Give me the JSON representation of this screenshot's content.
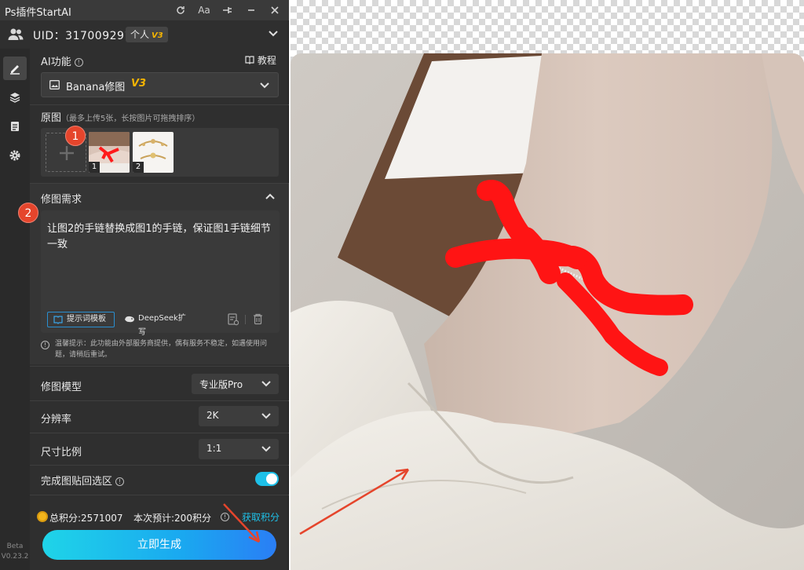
{
  "window": {
    "title": "Ps插件StartAI"
  },
  "user": {
    "uid": "UID：317009291",
    "tag": "个人",
    "tag_version": "V3"
  },
  "ai_function": {
    "label": "AI功能",
    "tutorial": "教程",
    "selected": "Banana修图",
    "selected_version": "V3"
  },
  "source_images": {
    "label": "原图",
    "hint": "（最多上传5张，长按图片可拖拽排序）",
    "items": [
      {
        "num": "1"
      },
      {
        "num": "2"
      }
    ]
  },
  "annotations": {
    "badge1": "1",
    "badge2": "2"
  },
  "edit_request": {
    "label": "修图需求",
    "text": "让图2的手链替换成图1的手链，保证图1手链细节一致",
    "template_button": "提示词模板",
    "deepseek_button": "DeepSeek扩写"
  },
  "notice": {
    "text": "温馨提示：此功能由外部服务商提供，偶有服务不稳定，如遇使用问题，请稍后重试。"
  },
  "settings": {
    "model": {
      "label": "修图模型",
      "value": "专业版Pro"
    },
    "resolution": {
      "label": "分辨率",
      "value": "2K"
    },
    "aspect": {
      "label": "尺寸比例",
      "value": "1:1"
    },
    "paste_back": {
      "label": "完成图贴回选区",
      "enabled": true
    }
  },
  "points": {
    "total": "总积分:2571007",
    "estimate": "本次预计:200积分",
    "get": "获取积分"
  },
  "generate_button": "立即生成",
  "version": {
    "beta": "Beta",
    "number": "V0.23.2"
  },
  "colors": {
    "accent": "#1ec0e8",
    "badge": "#e5452c",
    "vip": "#f5b400",
    "arrow": "#e5452c"
  }
}
